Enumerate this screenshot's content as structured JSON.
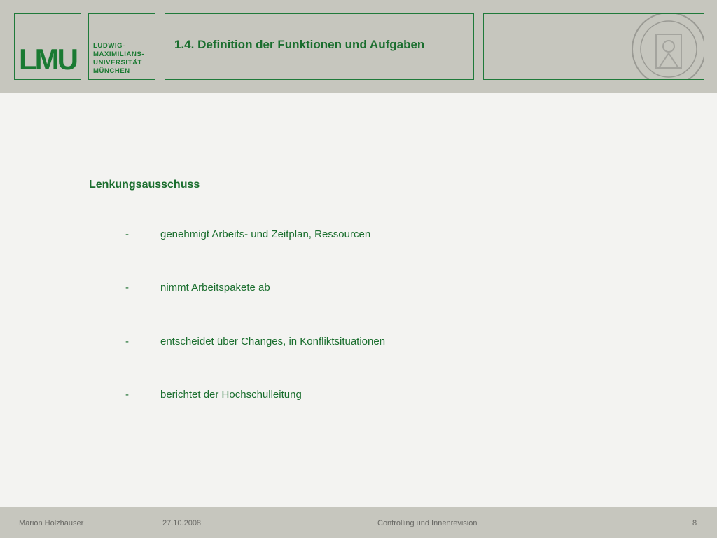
{
  "header": {
    "logo_text": "LMU",
    "university_lines": [
      "LUDWIG-",
      "MAXIMILIANS-",
      "UNIVERSITÄT",
      "MÜNCHEN"
    ],
    "title": "1.4. Definition der Funktionen und Aufgaben",
    "seal": "university-seal"
  },
  "content": {
    "heading": "Lenkungsausschuss",
    "bullet_symbol": "-",
    "items": [
      "genehmigt Arbeits- und Zeitplan, Ressourcen",
      "nimmt Arbeitspakete ab",
      "entscheidet über Changes, in Konfliktsituationen",
      "berichtet der Hochschulleitung"
    ]
  },
  "footer": {
    "author": "Marion Holzhauser",
    "date": "27.10.2008",
    "topic": "Controlling und Innenrevision",
    "page": "8"
  },
  "colors": {
    "accent": "#1a6e2e",
    "header_bg": "#c6c6be",
    "slide_bg": "#f3f3f1"
  }
}
